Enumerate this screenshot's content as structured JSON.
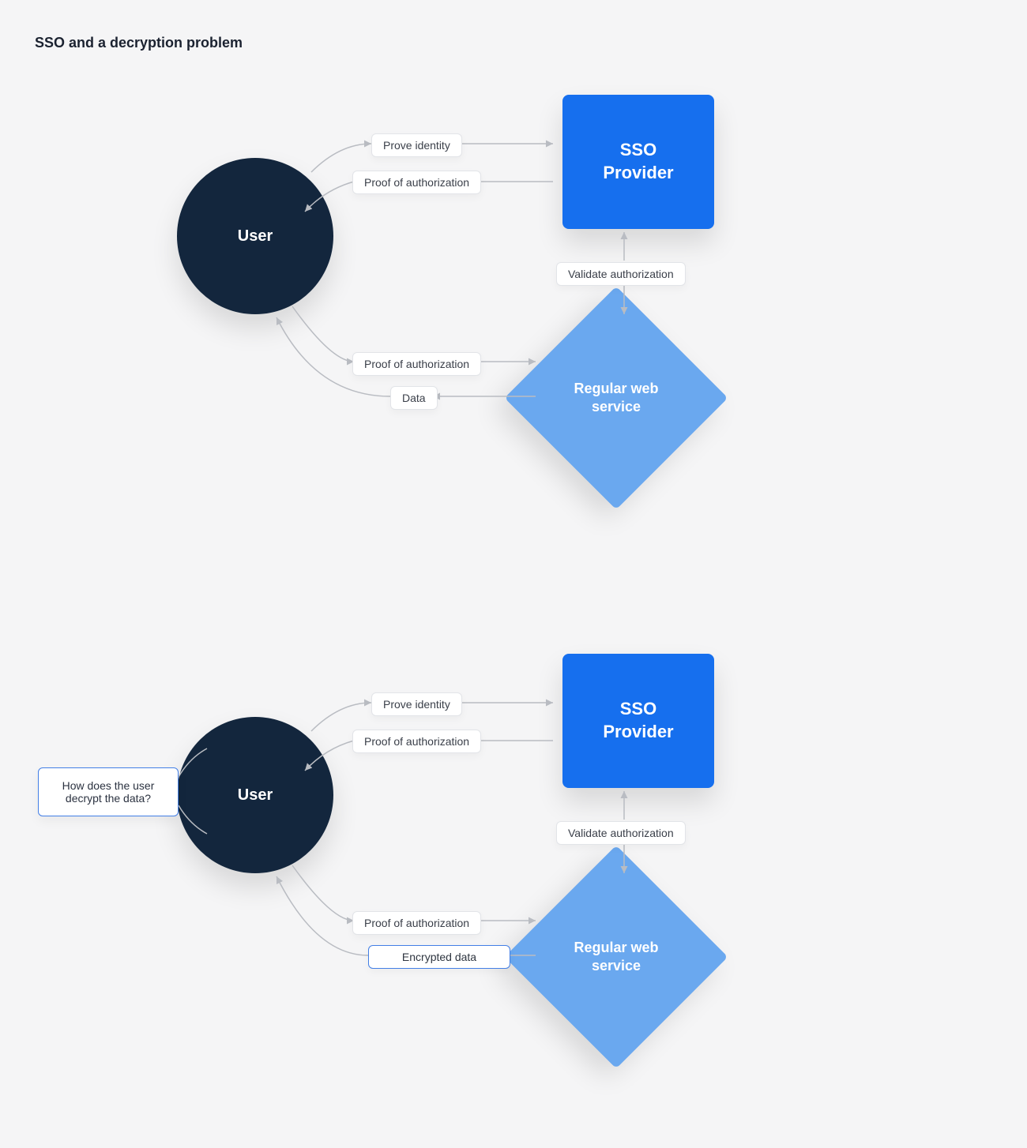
{
  "title": "SSO and a decryption problem",
  "nodes": {
    "user": "User",
    "sso": "SSO\nProvider",
    "service": "Regular web\nservice"
  },
  "labels": {
    "prove_identity": "Prove identity",
    "proof_of_authorization": "Proof of authorization",
    "validate_authorization": "Validate authorization",
    "data": "Data",
    "encrypted_data": "Encrypted data",
    "question": "How does the user decrypt the data?"
  },
  "diagrams": [
    {
      "id": "top",
      "flows": [
        {
          "from": "user",
          "to": "sso",
          "label_key": "prove_identity"
        },
        {
          "from": "sso",
          "to": "user",
          "label_key": "proof_of_authorization"
        },
        {
          "between": [
            "sso",
            "service"
          ],
          "label_key": "validate_authorization",
          "bidirectional": true
        },
        {
          "from": "user",
          "to": "service",
          "label_key": "proof_of_authorization"
        },
        {
          "from": "service",
          "to": "user",
          "label_key": "data"
        }
      ]
    },
    {
      "id": "bottom",
      "flows": [
        {
          "from": "user",
          "to": "sso",
          "label_key": "prove_identity"
        },
        {
          "from": "sso",
          "to": "user",
          "label_key": "proof_of_authorization"
        },
        {
          "between": [
            "sso",
            "service"
          ],
          "label_key": "validate_authorization",
          "bidirectional": true
        },
        {
          "from": "user",
          "to": "service",
          "label_key": "proof_of_authorization"
        },
        {
          "from": "service",
          "to": "user",
          "label_key": "encrypted_data",
          "highlight": true
        }
      ],
      "annotation": {
        "on": "user",
        "label_key": "question"
      }
    }
  ]
}
